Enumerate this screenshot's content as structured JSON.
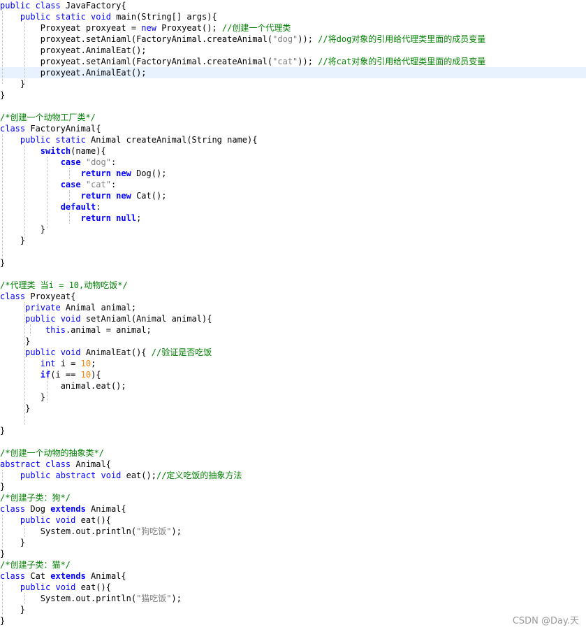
{
  "lines": [
    [
      {
        "t": "public class",
        "c": "kw"
      },
      {
        "t": " JavaFactory{"
      }
    ],
    [
      {
        "t": "    "
      },
      {
        "t": "public static void",
        "c": "kw"
      },
      {
        "t": " main(String[] args){"
      }
    ],
    [
      {
        "t": "        Proxyeat proxyeat = "
      },
      {
        "t": "new",
        "c": "kw"
      },
      {
        "t": " Proxyeat(); "
      },
      {
        "t": "//创建一个代理类",
        "c": "cm"
      }
    ],
    [
      {
        "t": "        proxyeat.setAniaml(FactoryAnimal.createAnimal("
      },
      {
        "t": "\"dog\"",
        "c": "str"
      },
      {
        "t": ")); "
      },
      {
        "t": "//将dog对象的引用给代理类里面的成员变量",
        "c": "cm"
      }
    ],
    [
      {
        "t": "        proxyeat.AnimalEat();"
      }
    ],
    [
      {
        "t": "        proxyeat.setAniaml(FactoryAnimal.createAnimal("
      },
      {
        "t": "\"cat\"",
        "c": "str"
      },
      {
        "t": ")); "
      },
      {
        "t": "//将cat对象的引用给代理类里面的成员变量",
        "c": "cm"
      }
    ],
    [
      {
        "t": "        proxyeat.AnimalEat();"
      }
    ],
    [
      {
        "t": "    }"
      }
    ],
    [
      {
        "t": "}"
      }
    ],
    [],
    [
      {
        "t": "/*创建一个动物工厂类*/",
        "c": "cm"
      }
    ],
    [
      {
        "t": "class",
        "c": "kw"
      },
      {
        "t": " FactoryAnimal{"
      }
    ],
    [
      {
        "t": "    "
      },
      {
        "t": "public static",
        "c": "kw"
      },
      {
        "t": " Animal createAnimal(String name){"
      }
    ],
    [
      {
        "t": "        "
      },
      {
        "t": "switch",
        "c": "kb"
      },
      {
        "t": "(name){"
      }
    ],
    [
      {
        "t": "            "
      },
      {
        "t": "case",
        "c": "kb"
      },
      {
        "t": " "
      },
      {
        "t": "\"dog\"",
        "c": "str"
      },
      {
        "t": ":"
      }
    ],
    [
      {
        "t": "                "
      },
      {
        "t": "return new",
        "c": "kb"
      },
      {
        "t": " Dog();"
      }
    ],
    [
      {
        "t": "            "
      },
      {
        "t": "case",
        "c": "kb"
      },
      {
        "t": " "
      },
      {
        "t": "\"cat\"",
        "c": "str"
      },
      {
        "t": ":"
      }
    ],
    [
      {
        "t": "                "
      },
      {
        "t": "return new",
        "c": "kb"
      },
      {
        "t": " Cat();"
      }
    ],
    [
      {
        "t": "            "
      },
      {
        "t": "default",
        "c": "kb"
      },
      {
        "t": ":"
      }
    ],
    [
      {
        "t": "                "
      },
      {
        "t": "return null",
        "c": "kb"
      },
      {
        "t": ";"
      }
    ],
    [
      {
        "t": "        }"
      }
    ],
    [
      {
        "t": "    }"
      }
    ],
    [],
    [
      {
        "t": "}"
      }
    ],
    [],
    [
      {
        "t": "/*代理类 当i = 10,动物吃饭*/",
        "c": "cm"
      }
    ],
    [
      {
        "t": "class",
        "c": "kw"
      },
      {
        "t": " Proxyeat{"
      }
    ],
    [
      {
        "t": "     "
      },
      {
        "t": "private",
        "c": "kw"
      },
      {
        "t": " Animal animal;"
      }
    ],
    [
      {
        "t": "     "
      },
      {
        "t": "public void",
        "c": "kw"
      },
      {
        "t": " setAniaml(Animal animal){"
      }
    ],
    [
      {
        "t": "         "
      },
      {
        "t": "this",
        "c": "kw"
      },
      {
        "t": ".animal = animal;"
      }
    ],
    [
      {
        "t": "     }"
      }
    ],
    [
      {
        "t": "     "
      },
      {
        "t": "public void",
        "c": "kw"
      },
      {
        "t": " AnimalEat(){ "
      },
      {
        "t": "//验证是否吃饭",
        "c": "cm"
      }
    ],
    [
      {
        "t": "        "
      },
      {
        "t": "int",
        "c": "kw"
      },
      {
        "t": " i = "
      },
      {
        "t": "10",
        "c": "num"
      },
      {
        "t": ";"
      }
    ],
    [
      {
        "t": "        "
      },
      {
        "t": "if",
        "c": "kb"
      },
      {
        "t": "(i == "
      },
      {
        "t": "10",
        "c": "num"
      },
      {
        "t": "){"
      }
    ],
    [
      {
        "t": "            animal.eat();"
      }
    ],
    [
      {
        "t": "        }"
      }
    ],
    [
      {
        "t": "     }"
      }
    ],
    [],
    [
      {
        "t": "}"
      }
    ],
    [],
    [
      {
        "t": "/*创建一个动物的抽象类*/",
        "c": "cm"
      }
    ],
    [
      {
        "t": "abstract class",
        "c": "kw"
      },
      {
        "t": " Animal{"
      }
    ],
    [
      {
        "t": "    "
      },
      {
        "t": "public abstract void",
        "c": "kw"
      },
      {
        "t": " eat();"
      },
      {
        "t": "//定义吃饭的抽象方法",
        "c": "cm"
      }
    ],
    [
      {
        "t": "}"
      }
    ],
    [
      {
        "t": "/*创建子类：狗*/",
        "c": "cm"
      }
    ],
    [
      {
        "t": "class",
        "c": "kw"
      },
      {
        "t": " Dog "
      },
      {
        "t": "extends",
        "c": "kb"
      },
      {
        "t": " Animal{"
      }
    ],
    [
      {
        "t": "    "
      },
      {
        "t": "public void",
        "c": "kw"
      },
      {
        "t": " eat(){"
      }
    ],
    [
      {
        "t": "        System.out.println("
      },
      {
        "t": "\"狗吃饭\"",
        "c": "str"
      },
      {
        "t": ");"
      }
    ],
    [
      {
        "t": "    }"
      }
    ],
    [
      {
        "t": "}"
      }
    ],
    [
      {
        "t": "/*创建子类：猫*/",
        "c": "cm"
      }
    ],
    [
      {
        "t": "class",
        "c": "kw"
      },
      {
        "t": " Cat "
      },
      {
        "t": "extends",
        "c": "kb"
      },
      {
        "t": " Animal{"
      }
    ],
    [
      {
        "t": "    "
      },
      {
        "t": "public void",
        "c": "kw"
      },
      {
        "t": " eat(){"
      }
    ],
    [
      {
        "t": "        System.out.println("
      },
      {
        "t": "\"猫吃饭\"",
        "c": "str"
      },
      {
        "t": ");"
      }
    ],
    [
      {
        "t": "    }"
      }
    ],
    [
      {
        "t": "}"
      }
    ]
  ],
  "highlighted_line": 6,
  "watermark": "CSDN @Day.天"
}
